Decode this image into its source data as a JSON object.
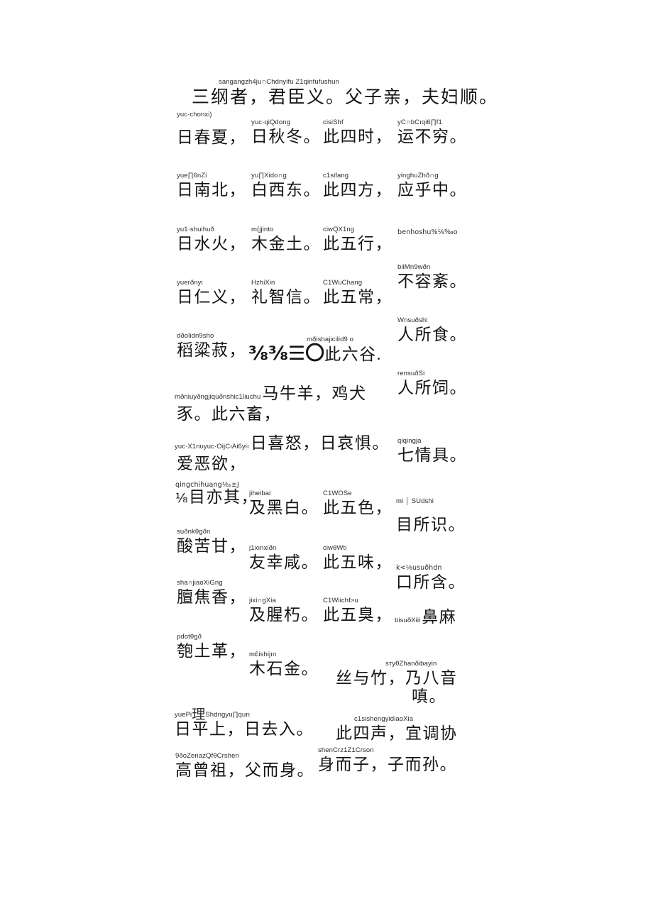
{
  "document": {
    "title": "三字经",
    "background_color": "#ffffff",
    "text_color": "#141414",
    "ruby_color": "#2b2b2b"
  },
  "lines": [
    {
      "id": "l01",
      "ruby": "sangangzh4ju∩Chdnyifu Z1qinfufushun",
      "han": "三纲者，君臣义。父子亲，夫妇顺。"
    },
    {
      "id": "l02",
      "ruby": "yuc·chonxi)",
      "han": "日春夏，"
    },
    {
      "id": "l03",
      "ruby": "yuc·qiQdong",
      "han": "日秋冬。"
    },
    {
      "id": "l04",
      "ruby": "cisiShf",
      "han": "此四时，"
    },
    {
      "id": "l05",
      "ruby": "yC∩bCıqi6∏f1",
      "han": "运不穷。"
    },
    {
      "id": "l06",
      "ruby": "yue∏6nZi",
      "han": "日南北，"
    },
    {
      "id": "l07",
      "ruby": "yu∏Xido∩g",
      "han": "白西东。"
    },
    {
      "id": "l08",
      "ruby": "c1sifang",
      "han": "此四方，"
    },
    {
      "id": "l09",
      "ruby": "yinghuZhð∩g",
      "han": "应乎中。"
    },
    {
      "id": "l10",
      "ruby": "yu1·shuihuð",
      "han": "日水火，"
    },
    {
      "id": "l11",
      "ruby": "m(jjinto",
      "han": "木金土。"
    },
    {
      "id": "l12",
      "ruby": "ciwQX1ng",
      "han": "此五行，"
    },
    {
      "id": "l13",
      "ruby": "benhoshu%⅛‰o",
      "han": ""
    },
    {
      "id": "l14",
      "ruby": "yuerðnyi",
      "han": "日仁义，"
    },
    {
      "id": "l15",
      "ruby": "HzhiXin",
      "han": "礼智信。"
    },
    {
      "id": "l16",
      "ruby": "C1WuChang",
      "han": "此五常，"
    },
    {
      "id": "l17",
      "ruby": "biiMn9wðn",
      "han": "不容紊。"
    },
    {
      "id": "l18",
      "ruby": "Wnsuðshi",
      "han": "人所食。"
    },
    {
      "id": "l19",
      "ruby": "dðolidn9sho",
      "han": "稻粱菽，"
    },
    {
      "id": "l20",
      "ruby": "mðishajicilid9 o",
      "han_garble": "⅜⅜☰〇",
      "han": "此六谷."
    },
    {
      "id": "l21",
      "ruby": "rensuðSi",
      "han": "人所饲。"
    },
    {
      "id": "l22",
      "ruby": "mðniuyðngjiquðnshic1liuchu",
      "han": "马牛羊，鸡犬"
    },
    {
      "id": "l23",
      "ruby": "",
      "han": "豕。此六畜，"
    },
    {
      "id": "l24",
      "ruby": "yuc·X1nuyuc·OijCıAi6yiı",
      "han": "日喜怒，日哀惧。"
    },
    {
      "id": "l25",
      "ruby": "",
      "han": "爱恶欲，"
    },
    {
      "id": "l26",
      "ruby": "qiqingja",
      "han": "七情具。"
    },
    {
      "id": "l27",
      "ruby": "qingchihuang⅛₁±J",
      "han_prefix": "⅛",
      "han": "目亦其，"
    },
    {
      "id": "l28",
      "ruby": "jiheibai",
      "han": "及黑白。"
    },
    {
      "id": "l29",
      "ruby": "C1WOSe",
      "han": "此五色，"
    },
    {
      "id": "l30",
      "ruby": "mi │ SUdshi",
      "han": "目所识。"
    },
    {
      "id": "l31",
      "ruby": "suðnkθgðn",
      "han": "酸苦甘，"
    },
    {
      "id": "l32",
      "ruby": "j1xınxiðn",
      "han": "友幸咸。"
    },
    {
      "id": "l33",
      "ruby": "ciwθWti",
      "han": "此五味，"
    },
    {
      "id": "l34",
      "ruby": "k<⅛usuðhdn",
      "han": "口所含。"
    },
    {
      "id": "l35",
      "ruby": "sha∩jiaoXiGng",
      "han": "膻焦香，"
    },
    {
      "id": "l36",
      "ruby": "jixi∩gXia",
      "han": "及腥朽。"
    },
    {
      "id": "l37",
      "ruby": "C1Wiichf>u",
      "han": "此五臭，"
    },
    {
      "id": "l38",
      "ruby": "bisuðXiii",
      "han": "鼻麻"
    },
    {
      "id": "l39",
      "ruby": "pdotθgð",
      "han": "匏土革，"
    },
    {
      "id": "l40",
      "ruby": "m£ishijın",
      "han": "木石金。"
    },
    {
      "id": "l41",
      "ruby": "sтyθZhanðibayin",
      "han": "丝与竹，乃八音"
    },
    {
      "id": "l42",
      "ruby": "",
      "han": "嗔。"
    },
    {
      "id": "l43",
      "ruby": "yuePi",
      "ruby_han": "理",
      "ruby_tail": "Shdngyu∏qurı",
      "han": "日平上，日去入。"
    },
    {
      "id": "l44",
      "ruby": "c1sishengyidiaoXia",
      "han": "此四声，宜调协"
    },
    {
      "id": "l45",
      "ruby": "9ðoZenazQfθCrshen",
      "han": "高曾祖，父而身。"
    },
    {
      "id": "l46",
      "ruby": "shenCrz1Z1Crson",
      "han": "身而子，子而孙。"
    }
  ]
}
